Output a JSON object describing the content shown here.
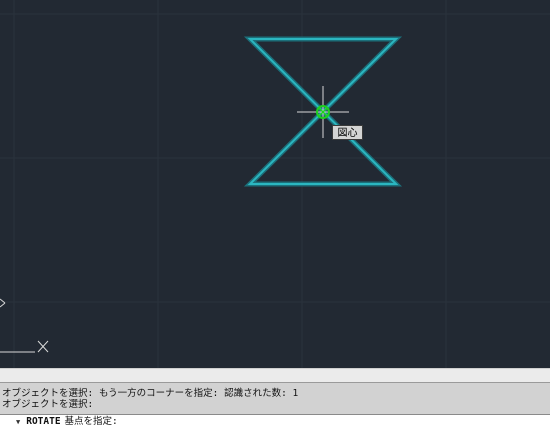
{
  "viewport": {
    "background": "#222933",
    "accent_shape_color": "#2bb6c0",
    "snap_marker_color": "#1fd11f",
    "osnap_tooltip": "図心"
  },
  "command_history": {
    "lines": [
      "オブジェクトを選択: もう一方のコーナーを指定: 認識された数: 1",
      "オブジェクトを選択:"
    ]
  },
  "command_line": {
    "command": "ROTATE",
    "prompt": "基点を指定:"
  }
}
